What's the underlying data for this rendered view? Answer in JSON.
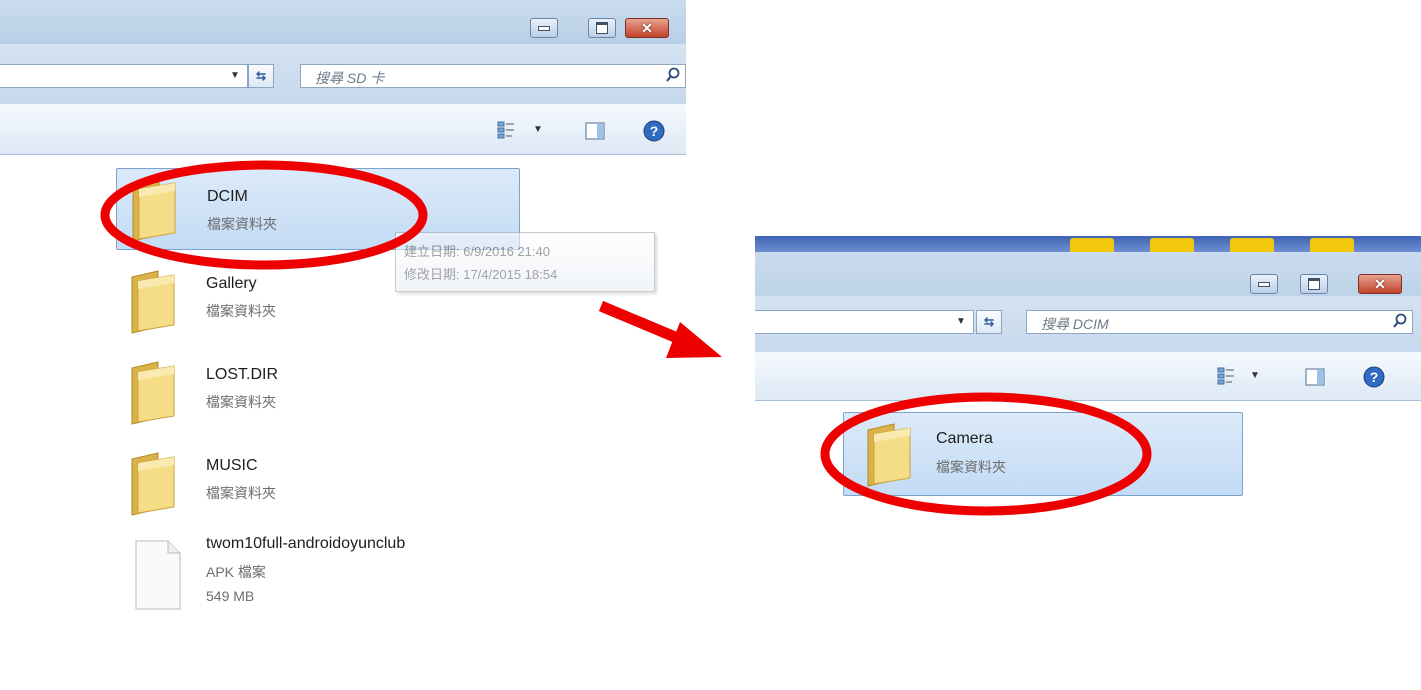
{
  "window1": {
    "search_placeholder": "搜尋 SD 卡",
    "files": [
      {
        "name": "DCIM",
        "type": "檔案資料夾",
        "icon": "folder-icon",
        "selected": true
      },
      {
        "name": "Gallery",
        "type": "檔案資料夾",
        "icon": "folder-icon"
      },
      {
        "name": "LOST.DIR",
        "type": "檔案資料夾",
        "icon": "folder-icon"
      },
      {
        "name": "MUSIC",
        "type": "檔案資料夾",
        "icon": "folder-icon"
      },
      {
        "name": "twom10full-androidoyunclub",
        "type": "APK 檔案",
        "size": "549 MB",
        "icon": "file-icon"
      }
    ],
    "tooltip": {
      "created": "建立日期: 6/9/2016 21:40",
      "modified": "修改日期: 17/4/2015 18:54"
    }
  },
  "window2": {
    "search_placeholder": "搜尋 DCIM",
    "files": [
      {
        "name": "Camera",
        "type": "檔案資料夾",
        "icon": "folder-icon",
        "selected": true
      }
    ]
  },
  "annotations": {
    "highlight_color": "#ee0000",
    "arrow_color": "#ee0000"
  },
  "colors": {
    "selection": "#cfe3f8",
    "chrome": "#c6d8ec",
    "close_button": "#c2432a"
  }
}
